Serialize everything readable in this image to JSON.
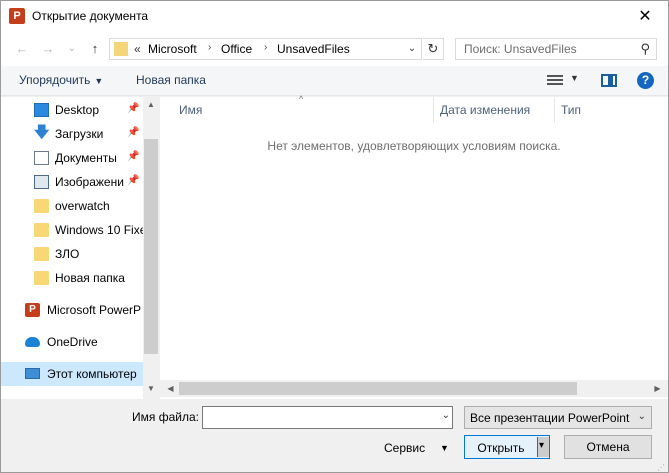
{
  "window": {
    "title": "Открытие документа",
    "app_icon": "P",
    "close_glyph": "✕"
  },
  "nav": {
    "back_glyph": "←",
    "forward_glyph": "→",
    "recent_glyph": "⌄",
    "up_glyph": "↑"
  },
  "address": {
    "overflow": "«",
    "crumbs": [
      "Microsoft",
      "Office",
      "UnsavedFiles"
    ],
    "separator": "›",
    "dropdown_glyph": "⌄",
    "refresh_glyph": "↻"
  },
  "search": {
    "placeholder": "Поиск: UnsavedFiles",
    "icon_glyph": "⚲"
  },
  "toolbar": {
    "organize_label": "Упорядочить",
    "organize_caret": "▼",
    "new_folder_label": "Новая папка",
    "view_caret": "▼",
    "help_glyph": "?"
  },
  "sidebar": {
    "items": [
      {
        "label": "Desktop",
        "icon": "desktop-icon",
        "pinned": true
      },
      {
        "label": "Загрузки",
        "icon": "download-icon",
        "pinned": true
      },
      {
        "label": "Документы",
        "icon": "documents-icon",
        "pinned": true
      },
      {
        "label": "Изображени",
        "icon": "pictures-icon",
        "pinned": true
      },
      {
        "label": "overwatch",
        "icon": "folder-icon",
        "pinned": false
      },
      {
        "label": "Windows 10 Fixe",
        "icon": "folder-icon",
        "pinned": false
      },
      {
        "label": "ЗЛО",
        "icon": "folder-icon",
        "pinned": false
      },
      {
        "label": "Новая папка",
        "icon": "folder-icon",
        "pinned": false
      },
      {
        "label": "Microsoft PowerP",
        "icon": "powerpoint-icon",
        "pinned": false
      },
      {
        "label": "OneDrive",
        "icon": "onedrive-icon",
        "pinned": false
      },
      {
        "label": "Этот компьютер",
        "icon": "computer-icon",
        "pinned": false,
        "selected": true
      }
    ],
    "pin_glyph": "📌",
    "down_glyph": "🡇",
    "ppt_glyph": "P",
    "scroll_up_glyph": "▲",
    "scroll_down_glyph": "▼"
  },
  "content": {
    "columns": [
      "Имя",
      "Дата изменения",
      "Тип"
    ],
    "sort_caret": "^",
    "empty_message": "Нет элементов, удовлетворяющих условиям поиска.",
    "scroll_left_glyph": "◀",
    "scroll_right_glyph": "▶"
  },
  "footer": {
    "filename_label": "Имя файла:",
    "filename_value": "",
    "filename_drop_glyph": "⌄",
    "filter_value": "Все презентации PowerPoint",
    "filter_drop_glyph": "⌄",
    "service_label": "Сервис",
    "service_caret": "▼",
    "open_label": "Открыть",
    "open_split_glyph": "▾",
    "cancel_label": "Отмена",
    "grip_glyph": "⋰"
  }
}
